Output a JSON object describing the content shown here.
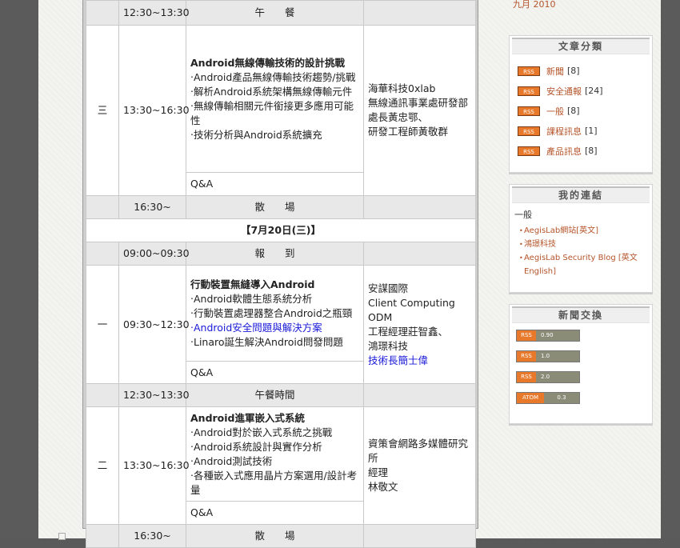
{
  "schedule": {
    "rows_top": {
      "lunch1": {
        "time": "12:30~13:30",
        "label": "午　　餐"
      },
      "wed": {
        "day": "三",
        "time": "13:30~16:30",
        "title": "Android無線傳輸技術的設計挑戰",
        "items": [
          "‧Android產品無線傳輸技術趨勢/挑戰",
          "‧解析Android系統架構無線傳輸元件",
          "‧無線傳輸相關元件銜接更多應用可能性",
          "‧技術分析與Android系統擴充"
        ],
        "qa": "Q&A",
        "speaker": [
          "海華科技0xlab",
          "無線通訊事業處研發部",
          "處長黃忠鄂、",
          "研發工程師黃敬群"
        ]
      },
      "dismiss1": {
        "time": "16:30~",
        "label": "散　　場"
      }
    },
    "date": "【7月20日(三)】",
    "rows_bottom": {
      "reg": {
        "time": "09:00~09:30",
        "label": "報　　到"
      },
      "mon": {
        "day": "一",
        "time": "09:30~12:30",
        "title": "行動裝置無縫導入Android",
        "items": [
          "‧Android軟體生態系統分析",
          "‧行動裝置處理器整合Android之瓶頸"
        ],
        "item_blue": "‧Android安全問題與解決方案",
        "item_last": "‧Linaro誕生解決Android問發問題",
        "qa": "Q&A",
        "speaker": [
          "安謀國際",
          "Client Computing ODM",
          "工程經理莊智鑫、",
          "鴻璟科技"
        ],
        "speaker_blue": "技術長簡士偉"
      },
      "lunch2": {
        "time": "12:30~13:30",
        "label": "午餐時間"
      },
      "tue": {
        "day": "二",
        "time": "13:30~16:30",
        "title": "Android進軍嵌入式系統",
        "items": [
          "‧Android對於嵌入式系統之挑戰",
          "‧Android系統設計與實作分析",
          "‧Android測試技術",
          "‧各種嵌入式應用晶片方案選用/設計考量"
        ],
        "qa": "Q&A",
        "speaker": [
          "資策會網路多媒體研究所",
          "經理",
          "林敬文"
        ]
      },
      "dismiss2": {
        "time": "16:30~",
        "label": "散　　場"
      }
    }
  },
  "sidebar": {
    "archive_link": "九月 2010",
    "categories": {
      "title": "文章分類",
      "badge": "RSS",
      "items": [
        {
          "label": "新聞",
          "count": "[8]"
        },
        {
          "label": "安全通報",
          "count": "[24]"
        },
        {
          "label": "一般",
          "count": "[8]"
        },
        {
          "label": "課程訊息",
          "count": "[1]"
        },
        {
          "label": "產品訊息",
          "count": "[8]"
        }
      ]
    },
    "links": {
      "title": "我的連結",
      "group": "一般",
      "items": [
        "AegisLab網站[英文]",
        "鴻璟科技",
        "AegisLab Security Blog [英文 English]"
      ]
    },
    "feeds": {
      "title": "新聞交換",
      "items": [
        {
          "tag": "RSS",
          "ver": "0.90"
        },
        {
          "tag": "RSS",
          "ver": "1.0"
        },
        {
          "tag": "RSS",
          "ver": "2.0"
        },
        {
          "tag": "ATOM",
          "ver": "0.3"
        }
      ]
    }
  },
  "colors": {
    "link": "#b5542a",
    "rss": "#e8792b",
    "blue_link": "#1a1ad8"
  }
}
